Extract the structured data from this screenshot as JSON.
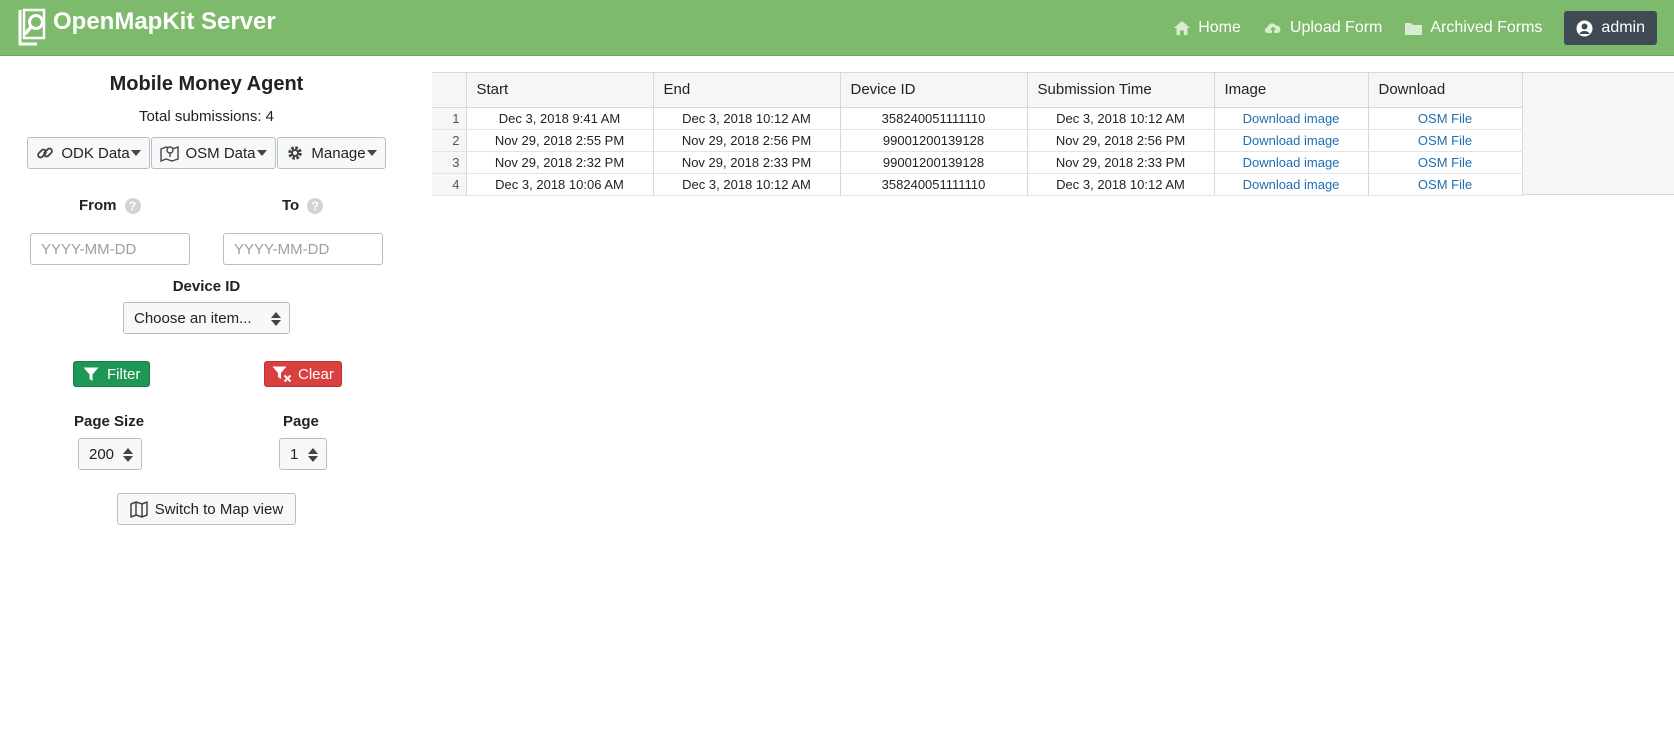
{
  "app": {
    "title": "OpenMapKit Server"
  },
  "nav": {
    "home": "Home",
    "upload_form": "Upload Form",
    "archived_forms": "Archived Forms",
    "user": "admin"
  },
  "sidebar": {
    "form_title": "Mobile Money Agent",
    "total_submissions": "Total submissions: 4",
    "odk_data": "ODK Data",
    "osm_data": "OSM Data",
    "manage": "Manage",
    "from_label": "From",
    "to_label": "To",
    "from_placeholder": "YYYY-MM-DD",
    "to_placeholder": "YYYY-MM-DD",
    "device_id_label": "Device ID",
    "device_id_selected": "Choose an item...",
    "filter": "Filter",
    "clear": "Clear",
    "page_size_label": "Page Size",
    "page_size_value": "200",
    "page_label": "Page",
    "page_value": "1",
    "map_view": "Switch to Map view"
  },
  "table": {
    "columns": [
      "Start",
      "End",
      "Device ID",
      "Submission Time",
      "Image",
      "Download"
    ],
    "rows": [
      {
        "n": "1",
        "start": "Dec 3, 2018 9:41 AM",
        "end": "Dec 3, 2018 10:12 AM",
        "device": "358240051111110",
        "submitted": "Dec 3, 2018 10:12 AM",
        "image": "Download image",
        "download": "OSM File"
      },
      {
        "n": "2",
        "start": "Nov 29, 2018 2:55 PM",
        "end": "Nov 29, 2018 2:56 PM",
        "device": "99001200139128",
        "submitted": "Nov 29, 2018 2:56 PM",
        "image": "Download image",
        "download": "OSM File"
      },
      {
        "n": "3",
        "start": "Nov 29, 2018 2:32 PM",
        "end": "Nov 29, 2018 2:33 PM",
        "device": "99001200139128",
        "submitted": "Nov 29, 2018 2:33 PM",
        "image": "Download image",
        "download": "OSM File"
      },
      {
        "n": "4",
        "start": "Dec 3, 2018 10:06 AM",
        "end": "Dec 3, 2018 10:12 AM",
        "device": "358240051111110",
        "submitted": "Dec 3, 2018 10:12 AM",
        "image": "Download image",
        "download": "OSM File"
      }
    ]
  },
  "colors": {
    "navbar": "#7dba6b",
    "admin_button": "#3f4a55",
    "filter_button": "#1e9654",
    "clear_button": "#d9403f",
    "link": "#1f6eb0"
  }
}
